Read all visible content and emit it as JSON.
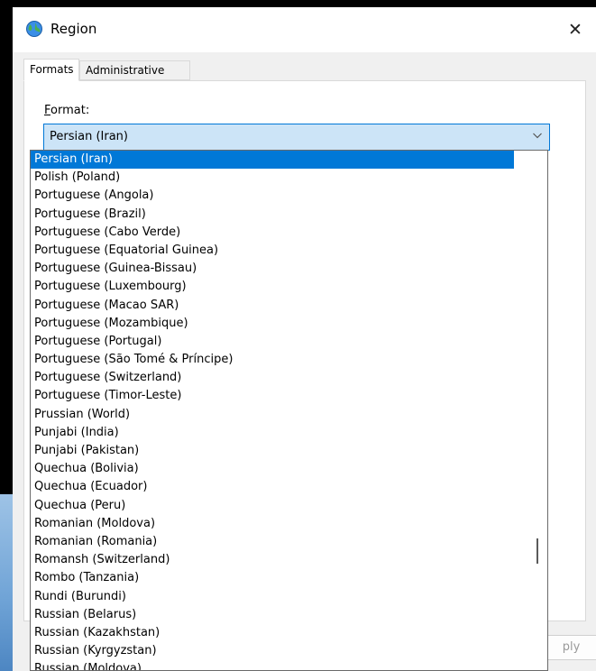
{
  "window": {
    "title": "Region",
    "close_glyph": "✕"
  },
  "tabs": [
    {
      "label": "Formats",
      "active": true
    },
    {
      "label": "Administrative",
      "active": false
    }
  ],
  "format": {
    "label_first": "F",
    "label_rest": "ormat:",
    "selected_value": "Persian (Iran)"
  },
  "dropdown": {
    "options": [
      "Persian (Iran)",
      "Polish (Poland)",
      "Portuguese (Angola)",
      "Portuguese (Brazil)",
      "Portuguese (Cabo Verde)",
      "Portuguese (Equatorial Guinea)",
      "Portuguese (Guinea-Bissau)",
      "Portuguese (Luxembourg)",
      "Portuguese (Macao SAR)",
      "Portuguese (Mozambique)",
      "Portuguese (Portugal)",
      "Portuguese (São Tomé & Príncipe)",
      "Portuguese (Switzerland)",
      "Portuguese (Timor-Leste)",
      "Prussian (World)",
      "Punjabi (India)",
      "Punjabi (Pakistan)",
      "Quechua (Bolivia)",
      "Quechua (Ecuador)",
      "Quechua (Peru)",
      "Romanian (Moldova)",
      "Romanian (Romania)",
      "Romansh (Switzerland)",
      "Rombo (Tanzania)",
      "Rundi (Burundi)",
      "Russian (Belarus)",
      "Russian (Kazakhstan)",
      "Russian (Kyrgyzstan)",
      "Russian (Moldova)"
    ],
    "selected_index": 0
  },
  "buttons": {
    "apply_partial": "ply"
  },
  "colors": {
    "selection": "#0078d7",
    "combo_fill": "#cce4f7"
  },
  "icons": {
    "title": "globe-icon",
    "close": "close-icon",
    "combo": "chevron-down-icon"
  }
}
